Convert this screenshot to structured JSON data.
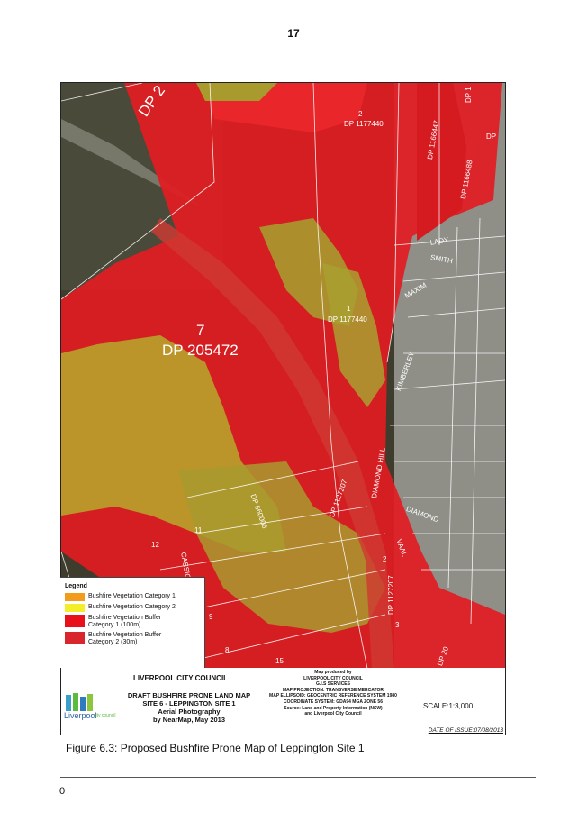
{
  "page_number": "17",
  "map": {
    "labels": {
      "dp2_top": "DP 2",
      "lot2": "2",
      "dp1177440_top": "DP 1177440",
      "dp1_corner": "DP 1",
      "dp1166447": "DP 1166447",
      "dp1166488": "DP 1166488",
      "dp_edge": "DP",
      "lady": "LADY",
      "smith": "SMITH",
      "maxim": "MAXIM",
      "lot1": "1",
      "dp1177440_mid": "DP 1177440",
      "lot7": "7",
      "dp205472": "DP 205472",
      "kimberley": "KIMBERLEY",
      "diamond_hill": "DIAMOND HILL",
      "dp1127207_mid": "DP 1127207",
      "dp660006": "DP 660006",
      "diamond": "DIAMOND",
      "vaal": "VAAL",
      "lot11": "11",
      "lot12": "12",
      "cassio": "CASSIO",
      "lot9": "9",
      "lot8": "8",
      "lot15": "15",
      "lot2b": "2",
      "dp1127207_bottom": "DP 1127207",
      "lot3": "3",
      "dp20_bottom": "DP 20"
    }
  },
  "legend": {
    "title": "Legend",
    "items": [
      {
        "label_lines": [
          "Bushfire Vegetation Category 1"
        ],
        "color": "#f39c1c"
      },
      {
        "label_lines": [
          "Bushfire Vegetation Category 2"
        ],
        "color": "#f4ee2a"
      },
      {
        "label_lines": [
          "Bushfire Vegetation Buffer",
          "Category 1 (100m)"
        ],
        "color": "#e8101a"
      },
      {
        "label_lines": [
          "Bushfire Vegetation Buffer",
          "Category 2 (30m)"
        ],
        "color": "#d9262d"
      }
    ]
  },
  "titleblock": {
    "council": "LIVERPOOL CITY COUNCIL",
    "logo_text": "Liverpool",
    "logo_suffix": "city council",
    "map_title_1": "DRAFT BUSHFIRE PRONE LAND MAP",
    "map_title_2": "SITE 6 - LEPPINGTON SITE 1",
    "map_title_3": "Aerial Photography",
    "map_title_4": "by NearMap, May 2013",
    "producer_1": "Map produced by",
    "producer_2": "LIVERPOOL CITY COUNCIL",
    "producer_3": "G.I.S SERVICES",
    "producer_4": "MAP PROJECTION: TRANSVERSE MERCATOR",
    "producer_5": "MAP ELLIPSOID: GEOCENTRIC REFERENCE SYSTEM 1980",
    "producer_6": "COORDINATE SYSTEM: GDA94 MGA ZONE 56",
    "producer_7": "Source: Land and Property Information (NSW)",
    "producer_8": "and Liverpool City Council",
    "scale": "SCALE:1:3,000",
    "date": "DATE OF ISSUE:07/08/2013"
  },
  "caption": "Figure 6.3: Proposed Bushfire Prone Map of Leppington Site 1",
  "footer_number": "0"
}
